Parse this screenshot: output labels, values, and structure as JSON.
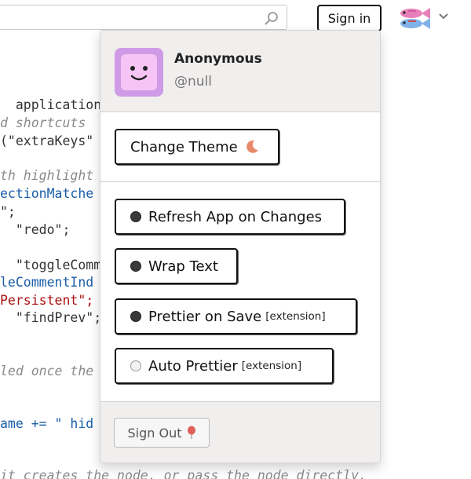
{
  "topbar": {
    "search_value": "",
    "search_icon": "search-icon",
    "signin_label": "Sign in",
    "avatar_icon": "fish-avatar-icon",
    "menu_icon": "chevron-down-icon"
  },
  "code_lines": [
    {
      "text": "  application",
      "kind": "plain"
    },
    {
      "text": "d shortcuts",
      "kind": "comment"
    },
    {
      "text": "(\"extraKeys\"",
      "kind": "plain"
    },
    {
      "text": "th highlight",
      "kind": "comment"
    },
    {
      "text": "ectionMatche",
      "kind": "var"
    },
    {
      "text": "\";",
      "kind": "plain"
    },
    {
      "text": "  \"redo\";",
      "kind": "plain"
    },
    {
      "text": "  \"toggleComm",
      "kind": "plain"
    },
    {
      "text": "leCommentInd",
      "kind": "var"
    },
    {
      "text": "Persistent\";",
      "kind": "str"
    },
    {
      "text": "  \"findPrev\";",
      "kind": "plain"
    },
    {
      "text": "led once the",
      "kind": "comment"
    },
    {
      "text": "ame += \" hid",
      "kind": "var"
    },
    {
      "text": "it creates the node, or pass the node directly.",
      "kind": "comment"
    }
  ],
  "profile": {
    "name": "Anonymous",
    "handle": "@null",
    "avatar_icon": "smiley-avatar-icon"
  },
  "menu": {
    "change_theme_label": "Change Theme",
    "theme_icon": "crescent-moon-icon",
    "options": [
      {
        "label": "Refresh App on Changes",
        "suffix": "",
        "checked": true
      },
      {
        "label": "Wrap Text",
        "suffix": "",
        "checked": true
      },
      {
        "label": "Prettier on Save",
        "suffix": "[extension]",
        "checked": true
      },
      {
        "label": "Auto Prettier",
        "suffix": "[extension]",
        "checked": false
      }
    ],
    "signout_label": "Sign Out",
    "signout_icon": "balloon-icon"
  },
  "colors": {
    "avatar_bg": "#cf9be6",
    "panel_header_bg": "#f1eeee",
    "button_border": "#111111",
    "balloon": "#e0605a",
    "moon": "#e8896b"
  }
}
